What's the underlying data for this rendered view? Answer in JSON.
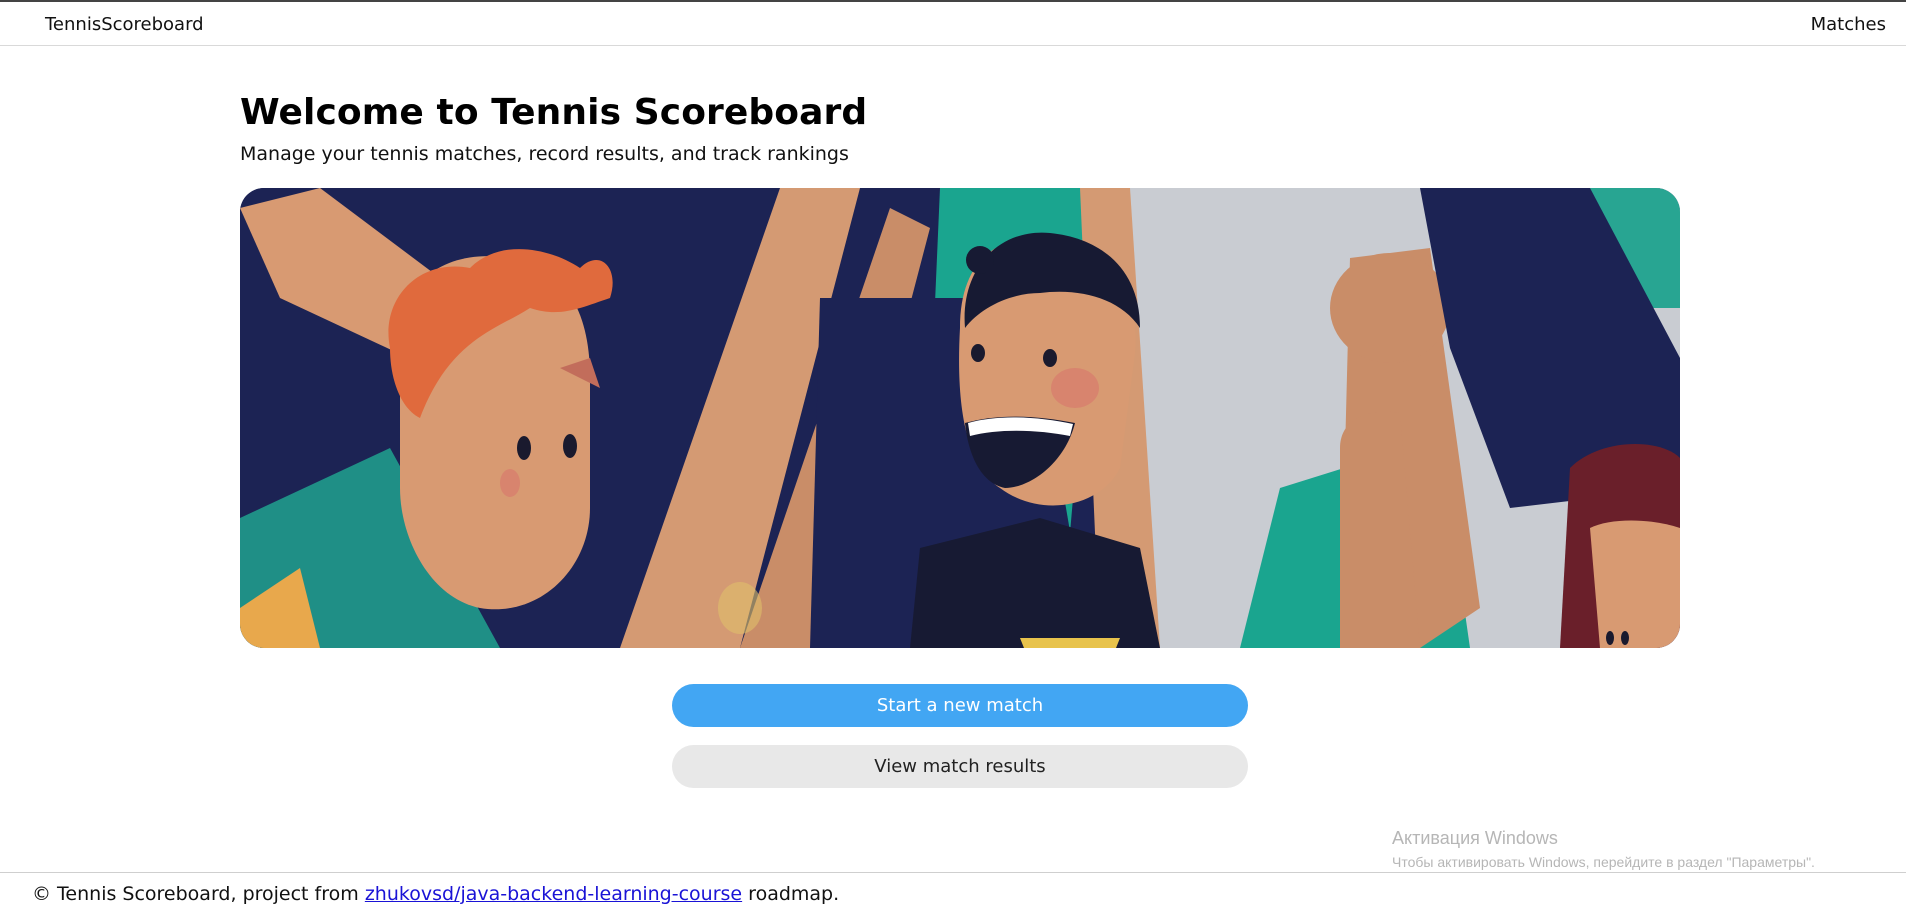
{
  "header": {
    "brand": "TennisScoreboard",
    "nav_matches": "Matches"
  },
  "hero": {
    "title": "Welcome to Tennis Scoreboard",
    "subtitle": "Manage your tennis matches, record results, and track rankings"
  },
  "actions": {
    "start_label": "Start a new match",
    "view_label": "View match results"
  },
  "footer": {
    "copyright_prefix": "© Tennis Scoreboard, project from",
    "link_text": "zhukovsd/java-backend-learning-course",
    "suffix": "roadmap."
  },
  "watermark": {
    "title": "Активация Windows",
    "text": "Чтобы активировать Windows, перейдите в раздел \"Параметры\"."
  },
  "colors": {
    "primary_button": "#42a6f3",
    "secondary_button": "#e8e8e8",
    "link": "#1a13d6"
  }
}
